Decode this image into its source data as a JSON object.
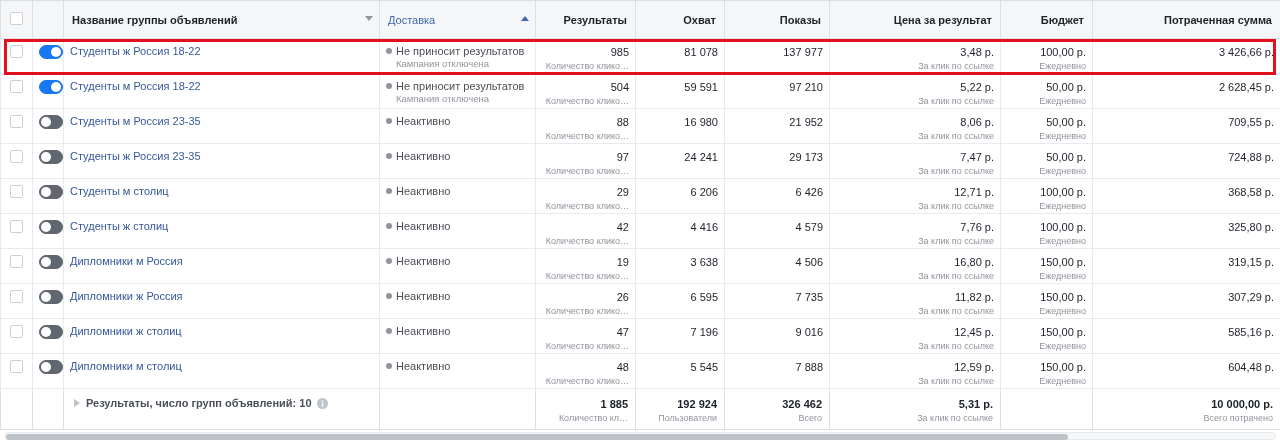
{
  "table": {
    "select_all": {
      "checked": false
    },
    "columns": [
      {
        "label": "Название группы объявлений",
        "kind": "menu"
      },
      {
        "label": "Доставка",
        "kind": "sorted"
      },
      {
        "label": "Результаты",
        "kind": "plain"
      },
      {
        "label": "Охват",
        "kind": "plain"
      },
      {
        "label": "Показы",
        "kind": "plain"
      },
      {
        "label": "Цена за результат",
        "kind": "plain"
      },
      {
        "label": "Бюджет",
        "kind": "plain"
      },
      {
        "label": "Потраченная сумма",
        "kind": "plain"
      }
    ],
    "rows": [
      {
        "checked": false,
        "on": true,
        "highlighted": true,
        "name": "Студенты ж Россия 18-22",
        "delivery": "Не приносит результатов",
        "delivery_note": "Кампания отключена",
        "results": "985",
        "results_note": "Количество клико…",
        "reach": "81 078",
        "impressions": "137 977",
        "price": "3,48 р.",
        "price_note": "За клик по ссылке",
        "budget": "100,00 р.",
        "budget_note": "Ежедневно",
        "spent": "3 426,66 р."
      },
      {
        "checked": false,
        "on": true,
        "highlighted": false,
        "name": "Студенты м Россия 18-22",
        "delivery": "Не приносит результатов",
        "delivery_note": "Кампания отключена",
        "results": "504",
        "results_note": "Количество клико…",
        "reach": "59 591",
        "impressions": "97 210",
        "price": "5,22 р.",
        "price_note": "За клик по ссылке",
        "budget": "50,00 р.",
        "budget_note": "Ежедневно",
        "spent": "2 628,45 р."
      },
      {
        "checked": false,
        "on": false,
        "highlighted": false,
        "name": "Студенты м Россия 23-35",
        "delivery": "Неактивно",
        "results": "88",
        "results_note": "Количество клико…",
        "reach": "16 980",
        "impressions": "21 952",
        "price": "8,06 р.",
        "price_note": "За клик по ссылке",
        "budget": "50,00 р.",
        "budget_note": "Ежедневно",
        "spent": "709,55 р."
      },
      {
        "checked": false,
        "on": false,
        "highlighted": false,
        "name": "Студенты ж Россия 23-35",
        "delivery": "Неактивно",
        "results": "97",
        "results_note": "Количество клико…",
        "reach": "24 241",
        "impressions": "29 173",
        "price": "7,47 р.",
        "price_note": "За клик по ссылке",
        "budget": "50,00 р.",
        "budget_note": "Ежедневно",
        "spent": "724,88 р."
      },
      {
        "checked": false,
        "on": false,
        "highlighted": false,
        "name": "Студенты м столиц",
        "delivery": "Неактивно",
        "results": "29",
        "results_note": "Количество клико…",
        "reach": "6 206",
        "impressions": "6 426",
        "price": "12,71 р.",
        "price_note": "За клик по ссылке",
        "budget": "100,00 р.",
        "budget_note": "Ежедневно",
        "spent": "368,58 р."
      },
      {
        "checked": false,
        "on": false,
        "highlighted": false,
        "name": "Студенты ж столиц",
        "delivery": "Неактивно",
        "results": "42",
        "results_note": "Количество клико…",
        "reach": "4 416",
        "impressions": "4 579",
        "price": "7,76 р.",
        "price_note": "За клик по ссылке",
        "budget": "100,00 р.",
        "budget_note": "Ежедневно",
        "spent": "325,80 р."
      },
      {
        "checked": false,
        "on": false,
        "highlighted": false,
        "name": "Дипломники м Россия",
        "delivery": "Неактивно",
        "results": "19",
        "results_note": "Количество клико…",
        "reach": "3 638",
        "impressions": "4 506",
        "price": "16,80 р.",
        "price_note": "За клик по ссылке",
        "budget": "150,00 р.",
        "budget_note": "Ежедневно",
        "spent": "319,15 р."
      },
      {
        "checked": false,
        "on": false,
        "highlighted": false,
        "name": "Дипломники ж Россия",
        "delivery": "Неактивно",
        "results": "26",
        "results_note": "Количество клико…",
        "reach": "6 595",
        "impressions": "7 735",
        "price": "11,82 р.",
        "price_note": "За клик по ссылке",
        "budget": "150,00 р.",
        "budget_note": "Ежедневно",
        "spent": "307,29 р."
      },
      {
        "checked": false,
        "on": false,
        "highlighted": false,
        "name": "Дипломники ж столиц",
        "delivery": "Неактивно",
        "results": "47",
        "results_note": "Количество клико…",
        "reach": "7 196",
        "impressions": "9 016",
        "price": "12,45 р.",
        "price_note": "За клик по ссылке",
        "budget": "150,00 р.",
        "budget_note": "Ежедневно",
        "spent": "585,16 р."
      },
      {
        "checked": false,
        "on": false,
        "highlighted": false,
        "name": "Дипломники м столиц",
        "delivery": "Неактивно",
        "results": "48",
        "results_note": "Количество клико…",
        "reach": "5 545",
        "impressions": "7 888",
        "price": "12,59 р.",
        "price_note": "За клик по ссылке",
        "budget": "150,00 р.",
        "budget_note": "Ежедневно",
        "spent": "604,48 р."
      }
    ],
    "summary": {
      "label": "Результаты, число групп объявлений: 10",
      "results": "1 885",
      "results_note": "Количество кл…",
      "reach": "192 924",
      "reach_note": "Пользователи",
      "impressions": "326 462",
      "impressions_note": "Всего",
      "price": "5,31 р.",
      "price_note": "За клик по ссылке",
      "spent": "10 000,00 р.",
      "spent_note": "Всего потрачено"
    }
  }
}
